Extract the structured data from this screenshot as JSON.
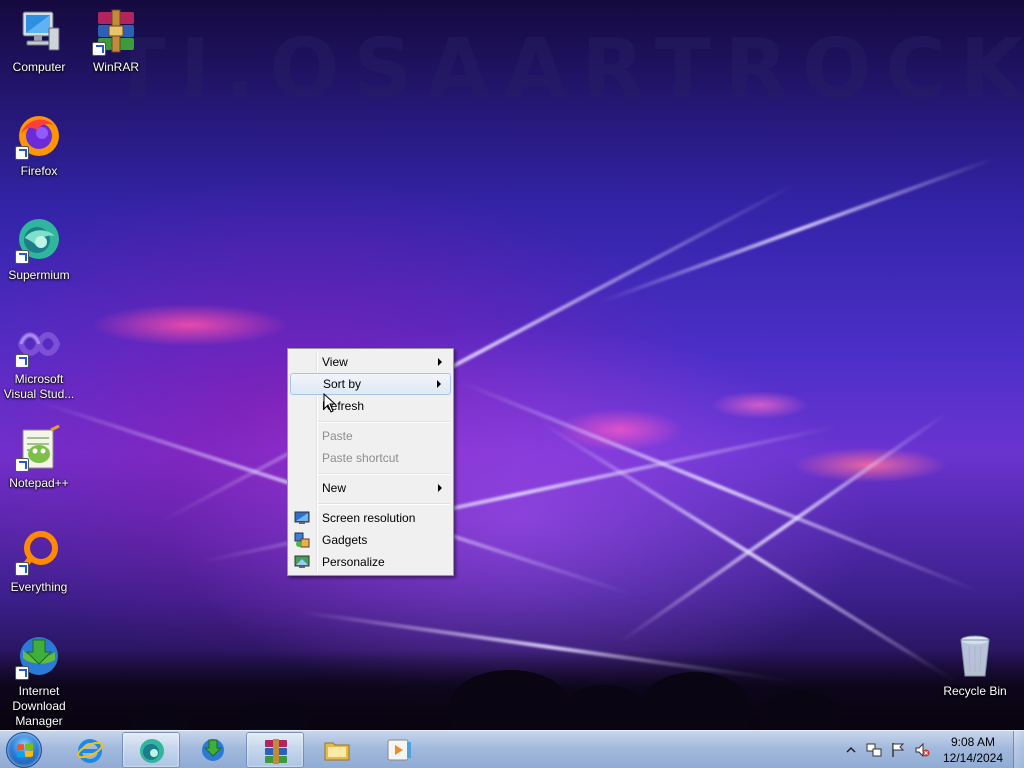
{
  "desktop": {
    "watermark": "TI.OSAARTROCK",
    "icons": [
      {
        "label": "Computer"
      },
      {
        "label": "WinRAR"
      },
      {
        "label": "Firefox"
      },
      {
        "label": "Supermium"
      },
      {
        "label": "Microsoft Visual Stud..."
      },
      {
        "label": "Notepad++"
      },
      {
        "label": "Everything"
      },
      {
        "label": "Internet Download Manager"
      },
      {
        "label": "Recycle Bin"
      }
    ]
  },
  "context_menu": {
    "items": [
      {
        "label": "View",
        "submenu": true,
        "state": "normal"
      },
      {
        "label": "Sort by",
        "submenu": true,
        "state": "hover"
      },
      {
        "label": "Refresh",
        "submenu": false,
        "state": "normal"
      },
      {
        "label": "Paste",
        "submenu": false,
        "state": "disabled"
      },
      {
        "label": "Paste shortcut",
        "submenu": false,
        "state": "disabled"
      },
      {
        "label": "New",
        "submenu": true,
        "state": "normal"
      },
      {
        "label": "Screen resolution",
        "icon": "monitor-icon"
      },
      {
        "label": "Gadgets",
        "icon": "gadgets-icon"
      },
      {
        "label": "Personalize",
        "icon": "personalize-icon"
      }
    ]
  },
  "taskbar": {
    "pinned": [
      {
        "icon": "internet-explorer-icon",
        "state": "normal"
      },
      {
        "icon": "supermium-icon",
        "state": "pressed"
      },
      {
        "icon": "internet-download-manager-icon",
        "state": "normal"
      },
      {
        "icon": "winrar-icon",
        "state": "pressed"
      },
      {
        "icon": "file-explorer-icon",
        "state": "normal"
      },
      {
        "icon": "media-player-icon",
        "state": "normal"
      }
    ],
    "tray": {
      "icons": [
        "show-hidden-icons-chevron",
        "network-icon",
        "action-center-flag-icon",
        "volume-muted-icon"
      ],
      "time": "9:08 AM",
      "date": "12/14/2024"
    }
  },
  "colors": {
    "menu_bg": "#f0f0f0",
    "menu_hover_border": "#a8c4ec",
    "menu_disabled_text": "#8d8d8d",
    "taskbar_tint": "#aac3e6"
  }
}
